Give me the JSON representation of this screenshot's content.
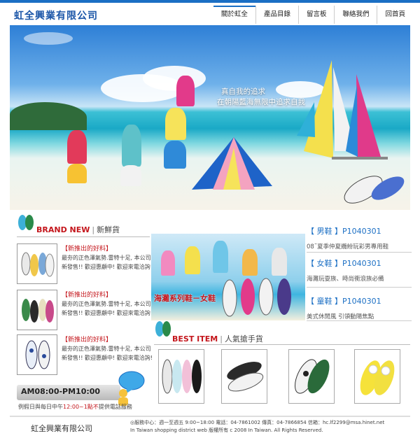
{
  "header": {
    "logo": "虹全興業有限公司",
    "nav": [
      "關於虹全",
      "產品目錄",
      "留言板",
      "聯絡我們",
      "回首頁"
    ]
  },
  "hero": {
    "tagline_1": "真自我的追求",
    "tagline_2": "在朝陽藍海無限中追求自我"
  },
  "brand_new": {
    "title_en": "BRAND NEW",
    "title_zh": "新鮮貨",
    "items": [
      {
        "title": "【新推出的好料】",
        "desc": "最夯的正色澤氣勢.雷特十足, 本公司新發售!! 歡迎惠顧中! 歡迎來電洽詢!"
      },
      {
        "title": "【新推出的好料】",
        "desc": "最夯的正色澤氣勢.雷特十足, 本公司新發售!! 歡迎惠顧中! 歡迎來電洽詢!"
      },
      {
        "title": "【新推出的好料】",
        "desc": "最夯的正色澤氣勢.雷特十足, 本公司新發售!! 歡迎惠顧中! 歡迎來電洽詢!"
      }
    ]
  },
  "promo": {
    "label": "海灘系列鞋－女鞋"
  },
  "categories": [
    {
      "head": "【 男鞋 】P1040301",
      "desc": "08˜夏季仲夏纜紛玩彩男專用鞋"
    },
    {
      "head": "【 女鞋 】P1040301",
      "desc": "海灘玩耍族、時尚衝浪族必備"
    },
    {
      "head": "【 童鞋 】P1040301",
      "desc": "美式休閒風 引領動陽焦點"
    }
  ],
  "best_item": {
    "title_en": "BEST ITEM",
    "title_zh": "人氣搶手貨"
  },
  "hours": {
    "time": "AM08:00-PM10:00",
    "note_prefix": "例假日與每日中午",
    "note_time": "12:00~1",
    "note_highlight": "點不",
    "note_suffix": "提供電話服務"
  },
  "footer": {
    "company": "虹全興業有限公司",
    "line1": "◎服務中心：週一至週五 9:00~18:00 電話：04-7861002 傳真：04-7866854 信箱：hc.lf2299@msa.hinet.net",
    "line2": "In Taiwan shopping district web 版權所有 c 2008 In Taiwan. All Rights Reserved."
  },
  "colors": {
    "accent": "#1b6fc4",
    "brand_red": "#c4161c"
  }
}
